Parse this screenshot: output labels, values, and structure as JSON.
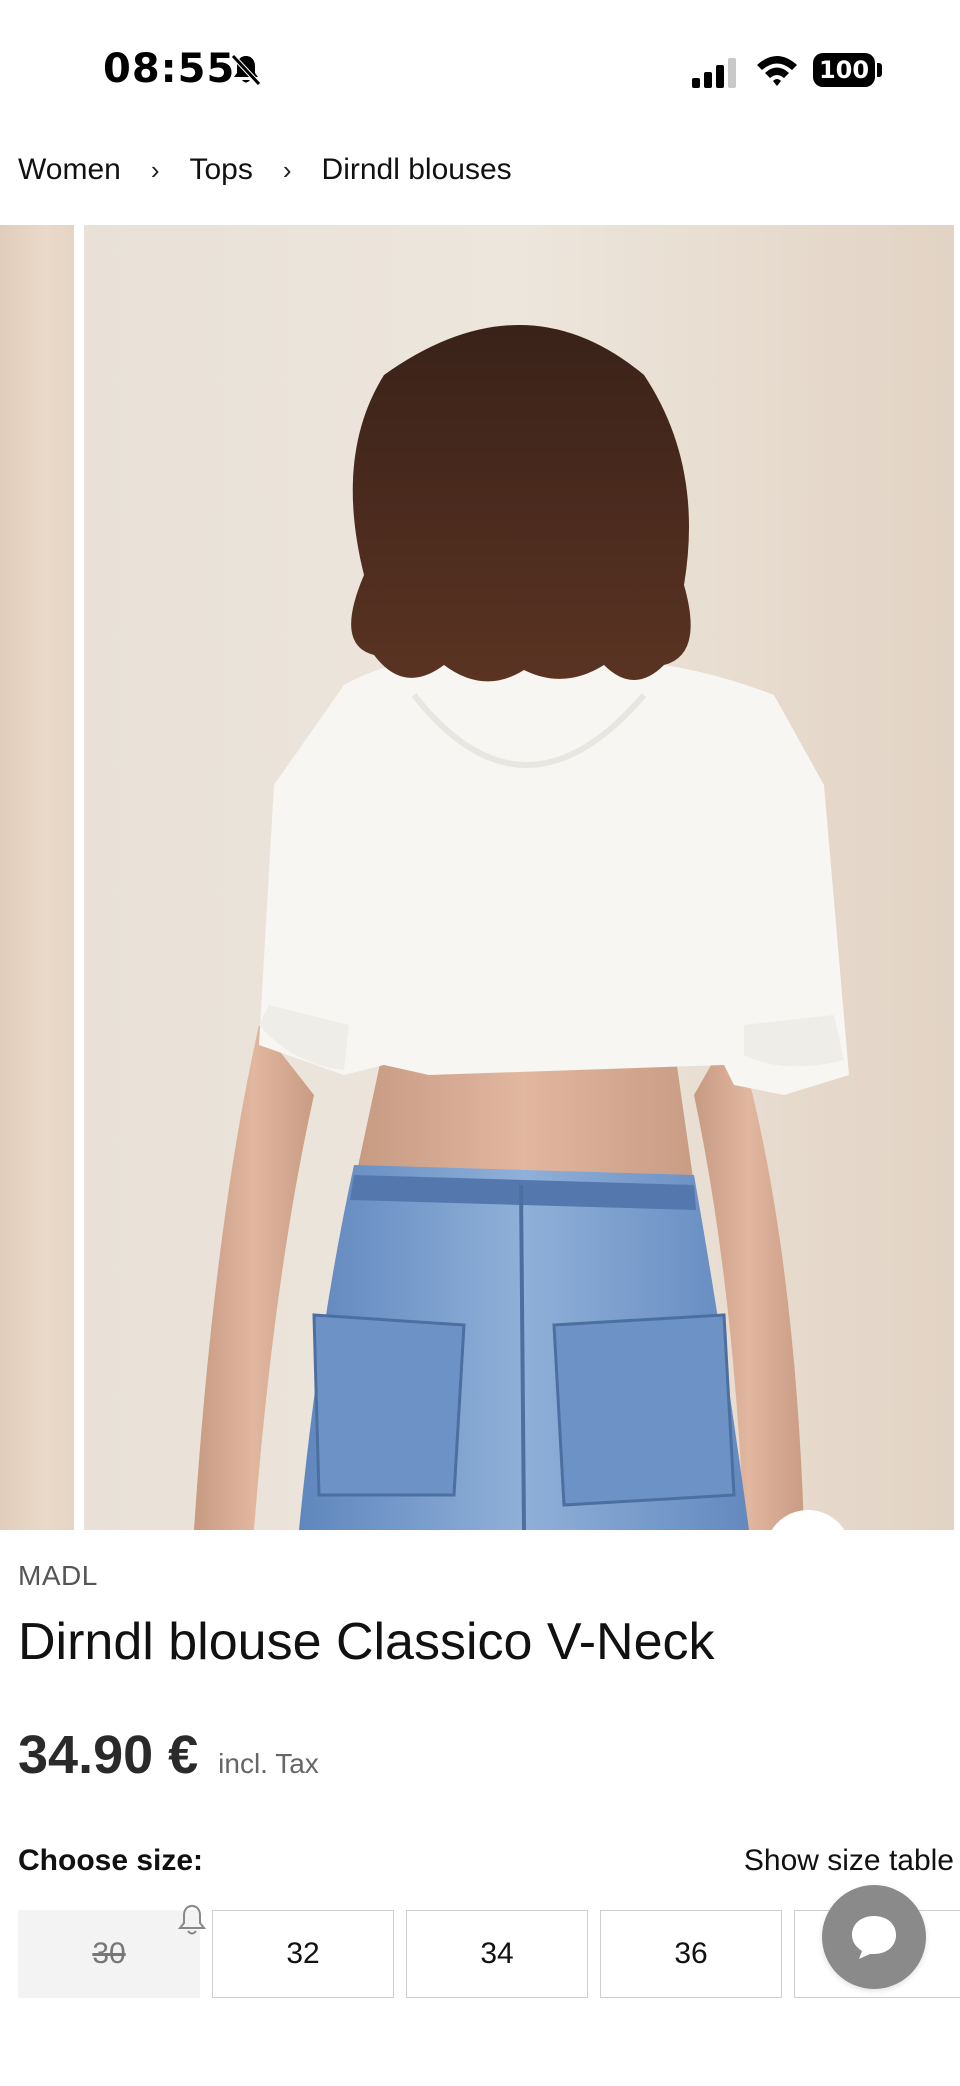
{
  "status_bar": {
    "time": "08:55",
    "battery": "100",
    "icons": [
      "bell-slash-icon",
      "signal-icon",
      "wifi-icon",
      "battery-icon"
    ]
  },
  "breadcrumb": {
    "items": [
      "Women",
      "Tops",
      "Dirndl blouses"
    ],
    "separator": "›"
  },
  "gallery": {
    "actions": [
      "share-icon",
      "heart-icon"
    ]
  },
  "product": {
    "brand": "MADL",
    "title": "Dirndl blouse Classico V-Neck",
    "price": "34.90 €",
    "tax_note": "incl. Tax"
  },
  "size": {
    "label": "Choose size:",
    "table_link": "Show size table",
    "options": [
      {
        "label": "30",
        "available": false
      },
      {
        "label": "32",
        "available": true
      },
      {
        "label": "34",
        "available": true
      },
      {
        "label": "36",
        "available": true
      }
    ]
  },
  "colors": {
    "text": "#111111",
    "muted": "#666666",
    "border": "#cfcfcf",
    "unavailable_bg": "#f3f3f3",
    "chat_button": "#8a8a8a"
  }
}
